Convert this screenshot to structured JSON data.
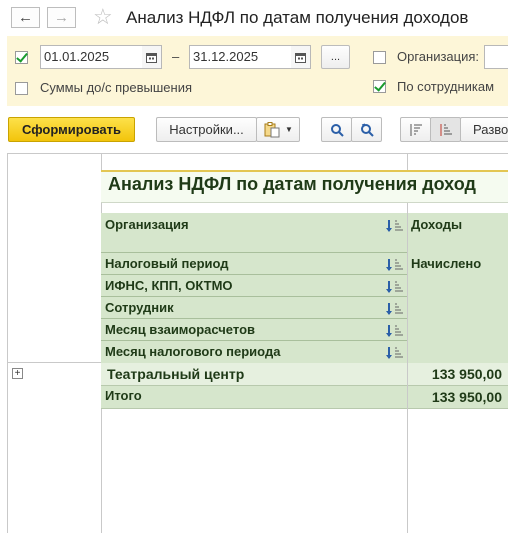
{
  "window": {
    "title": "Анализ НДФЛ по датам получения доходов"
  },
  "filters": {
    "period_checked": true,
    "date_from": "01.01.2025",
    "dash": "–",
    "date_to": "31.12.2025",
    "period_button": "...",
    "org_label": "Организация:",
    "org_checked": false,
    "sums_label": "Суммы до/с превышения",
    "sums_checked": false,
    "by_employee_label": "По сотрудникам",
    "by_employee_checked": true
  },
  "toolbar": {
    "generate_label": "Сформировать",
    "settings_label": "Настройки...",
    "expand_label": "Разво"
  },
  "report": {
    "title": "Анализ НДФЛ по датам получения доход",
    "grouping_headers": [
      "Организация",
      "Налоговый период",
      "ИФНС, КПП, ОКТМО",
      "Сотрудник",
      "Месяц взаиморасчетов",
      "Месяц налогового периода"
    ],
    "col_income": "Доходы",
    "col_accrued": "Начислено",
    "rows": [
      {
        "label": "Театральный центр",
        "value": "133 950,00"
      },
      {
        "label": "Итого",
        "value": "133 950,00"
      }
    ]
  },
  "colors": {
    "header_fill": "#d6e6cc",
    "row_fill": "#e6f0df",
    "accent": "#f2c40b"
  }
}
